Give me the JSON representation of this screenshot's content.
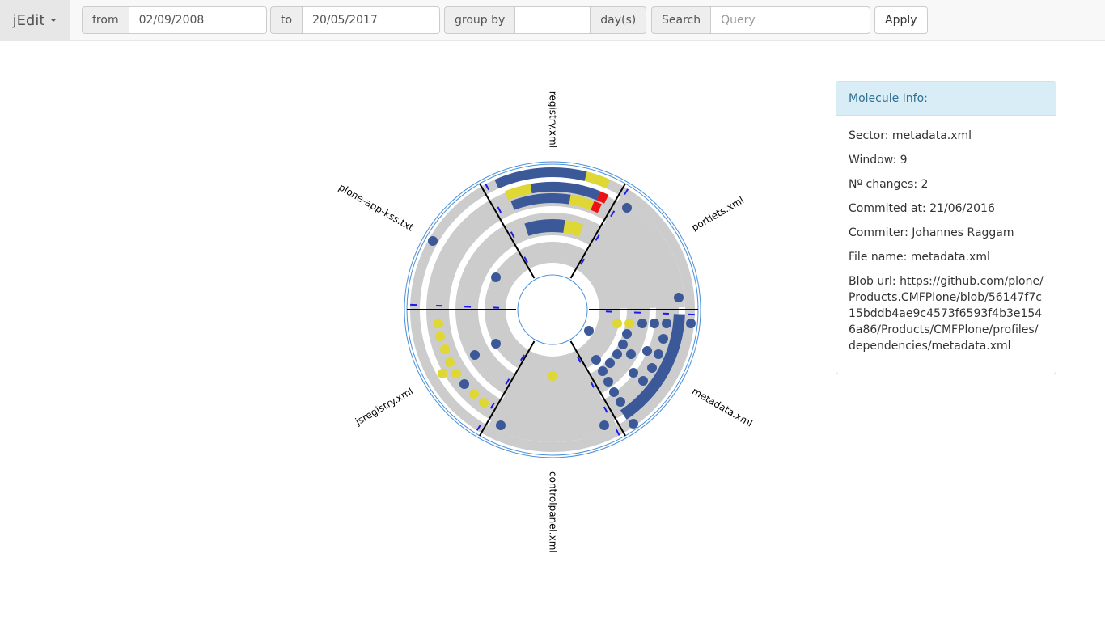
{
  "brand": {
    "label": "jEdit"
  },
  "filters": {
    "from_label": "from",
    "from_value": "02/09/2008",
    "to_label": "to",
    "to_value": "20/05/2017",
    "groupby_label": "group by",
    "groupby_value": "",
    "groupby_unit": "day(s)",
    "search_label": "Search",
    "search_placeholder": "Query",
    "apply_label": "Apply"
  },
  "chart": {
    "sectors": [
      "registry.xml",
      "portlets.xml",
      "metadata.xml",
      "controlpanel.xml",
      "jsregistry.xml",
      "plone-app-kss.txt"
    ],
    "colors": {
      "blue": "#3b5998",
      "yellow": "#dfd734",
      "red": "#ee1111",
      "grey": "#cccccc",
      "ring_border": "#4a90d9"
    }
  },
  "info": {
    "heading": "Molecule Info:",
    "sector": "Sector: metadata.xml",
    "window": "Window: 9",
    "changes": "Nº changes: 2",
    "commited": "Commited at: 21/06/2016",
    "commiter": "Commiter: Johannes Raggam",
    "filename": "File name: metadata.xml",
    "bloburl": "Blob url: https://github.com/plone/Products.CMFPlone/blob/56147f7c15bddb4ae9c4573f6593f4b3e1546a86/Products/CMFPlone/profiles/dependencies/metadata.xml"
  }
}
